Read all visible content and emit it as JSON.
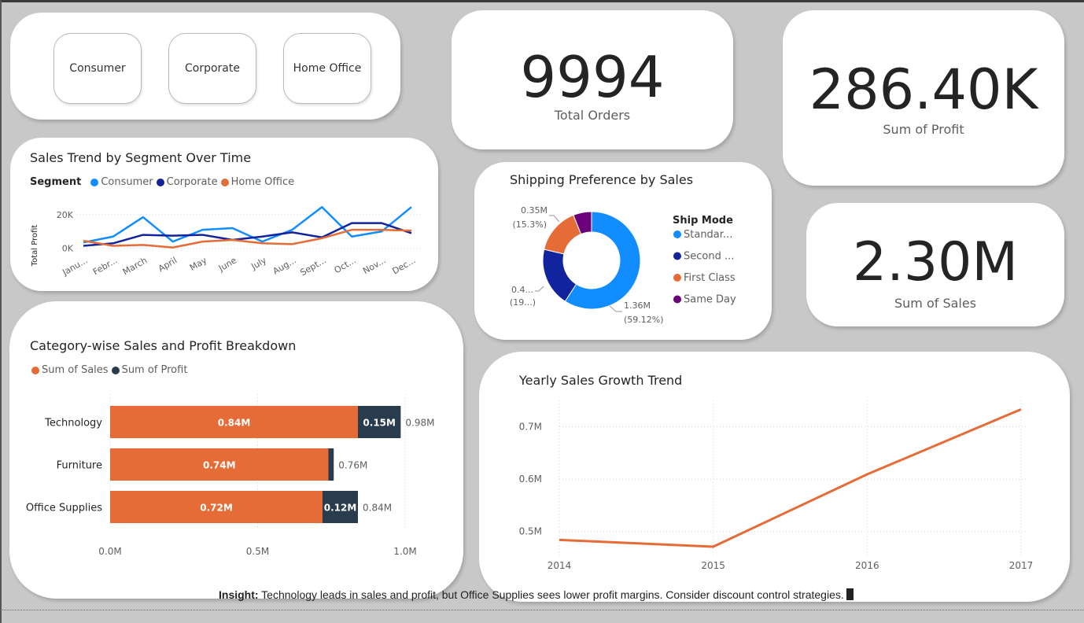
{
  "segments": {
    "buttons": [
      "Consumer",
      "Corporate",
      "Home Office"
    ]
  },
  "kpis": {
    "orders": {
      "value": "9994",
      "label": "Total Orders"
    },
    "profit": {
      "value": "286.40K",
      "label": "Sum of Profit"
    },
    "sales": {
      "value": "2.30M",
      "label": "Sum of Sales"
    }
  },
  "insight": {
    "label": "Insight:",
    "text": " Technology leads in sales and profit, but Office Supplies sees lower profit margins. Consider discount control strategies."
  },
  "colors": {
    "consumer": "#118DFF",
    "corporate": "#12239E",
    "home_office": "#E66C37",
    "same_day": "#6B007B",
    "profit_bar": "#283C4E"
  },
  "chart_data": [
    {
      "id": "trend",
      "type": "line",
      "title": "Sales Trend by Segment Over Time",
      "legend_title": "Segment",
      "ylabel": "Total Profit",
      "categories": [
        "Janu...",
        "Febr...",
        "March",
        "April",
        "May",
        "June",
        "July",
        "Aug...",
        "Sept...",
        "Oct...",
        "Nov...",
        "Dec..."
      ],
      "ylim": [
        -2000,
        26000
      ],
      "yticks": [
        {
          "v": 0,
          "label": "0K"
        },
        {
          "v": 20000,
          "label": "20K"
        }
      ],
      "series": [
        {
          "name": "Consumer",
          "color": "#118DFF",
          "values": [
            3500,
            7000,
            18500,
            4000,
            11000,
            12000,
            4000,
            11000,
            24500,
            7000,
            10000,
            24500
          ]
        },
        {
          "name": "Corporate",
          "color": "#12239E",
          "values": [
            1500,
            3000,
            8000,
            7500,
            8000,
            5000,
            7000,
            9500,
            6500,
            15000,
            15000,
            9000
          ]
        },
        {
          "name": "Home Office",
          "color": "#E66C37",
          "values": [
            4500,
            1500,
            2000,
            500,
            4000,
            5000,
            3000,
            2500,
            6000,
            11000,
            11000,
            10500
          ]
        }
      ]
    },
    {
      "id": "shipping",
      "type": "pie",
      "title": "Shipping Preference by Sales",
      "legend_title": "Ship Mode",
      "slices": [
        {
          "name": "Standar...",
          "value": 59.12,
          "color": "#118DFF"
        },
        {
          "name": "Second ...",
          "value": 19.5,
          "color": "#12239E"
        },
        {
          "name": "First Class",
          "value": 15.3,
          "color": "#E66C37"
        },
        {
          "name": "Same Day",
          "value": 6.08,
          "color": "#6B007B"
        }
      ],
      "data_labels": [
        {
          "line1": "1.36M",
          "line2": "(59.12%)"
        },
        {
          "line1": "0.4...",
          "line2": "(19...)"
        },
        {
          "line1": "0.35M",
          "line2": "(15.3%)"
        }
      ]
    },
    {
      "id": "category",
      "type": "bar",
      "title": "Category-wise Sales and Profit Breakdown",
      "orientation": "horizontal-stacked",
      "categories": [
        "Technology",
        "Furniture",
        "Office Supplies"
      ],
      "xlim": [
        0,
        1.0
      ],
      "xticks": [
        {
          "v": 0,
          "label": "0.0M"
        },
        {
          "v": 0.5,
          "label": "0.5M"
        },
        {
          "v": 1.0,
          "label": "1.0M"
        }
      ],
      "series": [
        {
          "name": "Sum of Sales",
          "color": "#E66C37",
          "values": [
            0.84,
            0.74,
            0.72
          ],
          "labels": [
            "0.84M",
            "0.74M",
            "0.72M"
          ]
        },
        {
          "name": "Sum of Profit",
          "color": "#283C4E",
          "values": [
            0.145,
            0.018,
            0.12
          ],
          "labels": [
            "0.15M",
            "",
            "0.12M"
          ]
        }
      ],
      "totals": [
        "0.98M",
        "0.76M",
        "0.84M"
      ]
    },
    {
      "id": "yearly",
      "type": "line",
      "title": "Yearly Sales Growth Trend",
      "x": [
        "2014",
        "2015",
        "2016",
        "2017"
      ],
      "ylim": [
        0.45,
        0.75
      ],
      "yticks": [
        {
          "v": 0.5,
          "label": "0.5M"
        },
        {
          "v": 0.6,
          "label": "0.6M"
        },
        {
          "v": 0.7,
          "label": "0.7M"
        }
      ],
      "series": [
        {
          "color": "#E66C37",
          "values": [
            0.484,
            0.471,
            0.609,
            0.733
          ]
        }
      ]
    }
  ]
}
